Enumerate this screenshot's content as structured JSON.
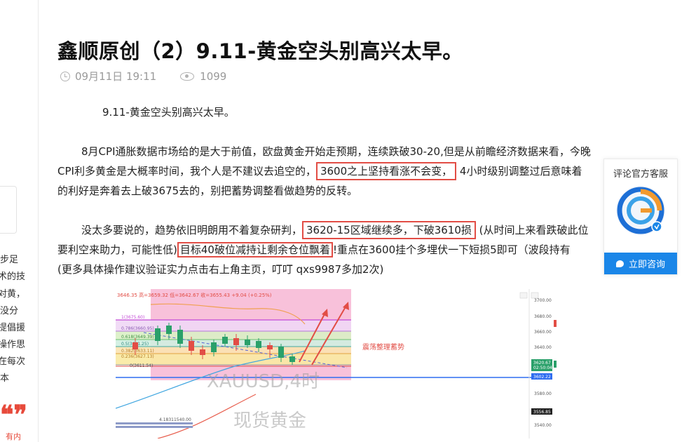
{
  "article": {
    "title": "鑫顺原创（2）9.11-黄金空头别高兴太早。",
    "date": "09月11日 19:11",
    "views": "1099",
    "subtitle": "9.11-黄金空头别高兴太早。",
    "p1": {
      "l1": "8月CPI通胀数据市场给的是大于前值，欧盘黄金开始走预期，连续跌破30-20,但是从前瞻经济数据来看，今晚",
      "l2a": "CPI利多黄金是大概率时间，我个人是不建议去追空的，",
      "l2b": "3600之上坚持看涨不会变，",
      "l2c": "4小时级别调整过后意味着",
      "l3": "的利好是奔着去上破3675去的，别把蓄势调整看做趋势的反转。"
    },
    "p2": {
      "l1a": "没太多要说的，趋势依旧明朗用不着复杂研判，",
      "l1b": "3620-15区域继续多，下破3610损",
      "l1c": "(从时间上来看跌破此位",
      "l2a": "要利空来助力，可能性低)",
      "l2b": "目标40破位减持让剩余仓位飘着",
      "l2c": "!重点在3600挂个多埋伏一下短损5即可（波段持有",
      "l3": "(更多具体操作建议验证实力点击右上角主页，叮叮  qxs9987多加2次)"
    }
  },
  "sidebar_fragments": [
    "步足",
    "术的技",
    "，对黄",
    "没分",
    "提倡援",
    "操作思",
    "在每次",
    "本",
    "有内"
  ],
  "chart": {
    "ticker_text": "3646.35  高=3659.32  低=3642.67  收=3655.43  +9.04 (+0.25%)",
    "y_axis": [
      "3700.00",
      "3680.00",
      "3660.00",
      "3640.00",
      "3620.00",
      "3602.22",
      "3580.00",
      "3556.85",
      "3540.00"
    ],
    "price_tag": "3620.67",
    "price_time": "02:50:04",
    "fib_labels": [
      "1(3675.60)",
      "0.786(3660.95)",
      "0.618(3649.39)",
      "0.5(3641.25)",
      "0.382(3633.11)",
      "0.236(3627.13)",
      "0(3611.54)"
    ],
    "annotation": "震荡整理蓄势",
    "watermark_symbol": "XAUUSD,4时",
    "watermark_name": "现货黄金",
    "bottom_label": "4.18311540.00"
  },
  "service": {
    "title": "评论官方客服",
    "button": "立即咨询"
  },
  "colors": {
    "highlight": "#e24d45",
    "button": "#1a86e8",
    "chart_zone": "#f7b6d3"
  }
}
